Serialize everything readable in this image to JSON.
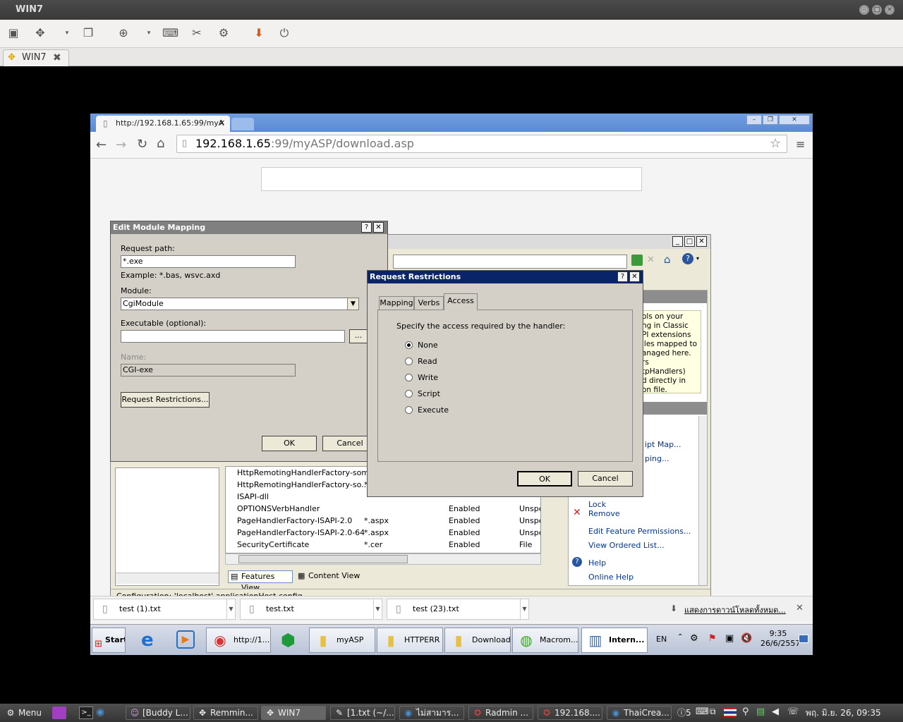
{
  "outer": {
    "title": "WIN7",
    "tab_label": "WIN7"
  },
  "chrome": {
    "tab_title": "http://192.168.1.65:99/myA",
    "url_host": "192.168.1.65",
    "url_rest": ":99/myASP/download.asp"
  },
  "iis": {
    "status": "Configuration: 'localhost' applicationHost.config",
    "help_lines": [
      "ols on your",
      "ng in Classic",
      "PI extensions",
      "iles mapped to",
      "anaged here.",
      "rs",
      "tpHandlers)",
      "d directly in",
      "on file."
    ],
    "actions": {
      "script_map": "ipt Map...",
      "mapping": "ping...",
      "lock": "Lock",
      "remove": "Remove",
      "edit_permissions": "Edit Feature Permissions...",
      "view_ordered": "View Ordered List...",
      "help": "Help",
      "online_help": "Online Help"
    },
    "rows": [
      {
        "name": "HttpRemotingHandlerFactory-som...",
        "path": "",
        "state": "",
        "type": ""
      },
      {
        "name": "HttpRemotingHandlerFactory-so...",
        "path": "*",
        "state": "",
        "type": ""
      },
      {
        "name": "ISAPI-dll",
        "path": "",
        "state": "",
        "type": ""
      },
      {
        "name": "OPTIONSVerbHandler",
        "path": "",
        "state": "Enabled",
        "type": "Unspe"
      },
      {
        "name": "PageHandlerFactory-ISAPI-2.0",
        "path": "*.aspx",
        "state": "Enabled",
        "type": "Unspe"
      },
      {
        "name": "PageHandlerFactory-ISAPI-2.0-64",
        "path": "*.aspx",
        "state": "Enabled",
        "type": "Unspe"
      },
      {
        "name": "SecurityCertificate",
        "path": "*.cer",
        "state": "Enabled",
        "type": "File"
      }
    ],
    "features_view": "Features View",
    "content_view": "Content View"
  },
  "edit_mapping": {
    "title": "Edit Module Mapping",
    "request_path_label": "Request path:",
    "request_path_value": "*.exe",
    "example": "Example: *.bas, wsvc.axd",
    "module_label": "Module:",
    "module_value": "CgiModule",
    "executable_label": "Executable (optional):",
    "executable_value": "",
    "browse": "...",
    "name_label": "Name:",
    "name_value": "CGI-exe",
    "restrictions_button": "Request Restrictions...",
    "ok": "OK",
    "cancel": "Cancel"
  },
  "restrictions": {
    "title": "Request Restrictions",
    "tabs": [
      "Mapping",
      "Verbs",
      "Access"
    ],
    "prompt": "Specify the access required by the handler:",
    "options": [
      "None",
      "Read",
      "Write",
      "Script",
      "Execute"
    ],
    "selected": "None",
    "ok": "OK",
    "cancel": "Cancel"
  },
  "downloads": {
    "items": [
      "test (1).txt",
      "test.txt",
      "test (23).txt"
    ],
    "show_all": "แสดงการดาวน์โหลดทั้งหมด..."
  },
  "win7_taskbar": {
    "start": "Start",
    "buttons": [
      "http://1...",
      "myASP",
      "HTTPERR",
      "Downloads",
      "Macrom...",
      "Intern..."
    ],
    "lang": "EN",
    "time": "9:35",
    "date": "26/6/2557"
  },
  "ubuntu_panel": {
    "menu": "Menu",
    "items": [
      "[Buddy L...",
      "Remmin...",
      "WIN7",
      "[1.txt (~/...",
      "ไม่สามาร...",
      "Radmin ...",
      "192.168....",
      "ThaiCrea..."
    ],
    "clock": "พฤ. มิ.ย. 26, 09:35",
    "indicator": "5"
  },
  "colors": {
    "chrome_frame": "#5b8ad4",
    "dialog_bg": "#d4d0c8",
    "restrictions_title": "#0a246a",
    "link": "#003399"
  }
}
